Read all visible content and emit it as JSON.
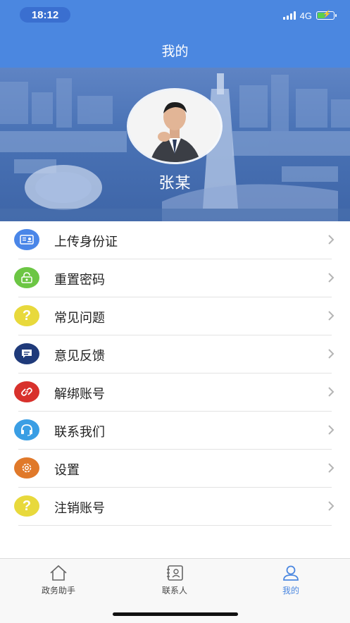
{
  "status_bar": {
    "time": "18:12",
    "network": "4G"
  },
  "header": {
    "title": "我的"
  },
  "profile": {
    "name": "张某"
  },
  "menu": {
    "items": [
      {
        "label": "上传身份证",
        "icon": "id-card-icon",
        "color": "#4a86e8"
      },
      {
        "label": "重置密码",
        "icon": "lock-icon",
        "color": "#6cc644"
      },
      {
        "label": "常见问题",
        "icon": "question-icon",
        "color": "#e8d93c"
      },
      {
        "label": "意见反馈",
        "icon": "feedback-icon",
        "color": "#1f3a7a"
      },
      {
        "label": "解绑账号",
        "icon": "unlink-icon",
        "color": "#d8312c"
      },
      {
        "label": "联系我们",
        "icon": "headset-icon",
        "color": "#3a9ee4"
      },
      {
        "label": "设置",
        "icon": "gear-icon",
        "color": "#e0792a"
      },
      {
        "label": "注销账号",
        "icon": "question-icon",
        "color": "#e8d93c"
      }
    ]
  },
  "tabbar": {
    "tabs": [
      {
        "label": "政务助手",
        "icon": "home-icon",
        "active": false
      },
      {
        "label": "联系人",
        "icon": "contacts-icon",
        "active": false
      },
      {
        "label": "我的",
        "icon": "user-icon",
        "active": true
      }
    ]
  },
  "colors": {
    "brand": "#4b87e0",
    "active_tab": "#4b87e0"
  }
}
